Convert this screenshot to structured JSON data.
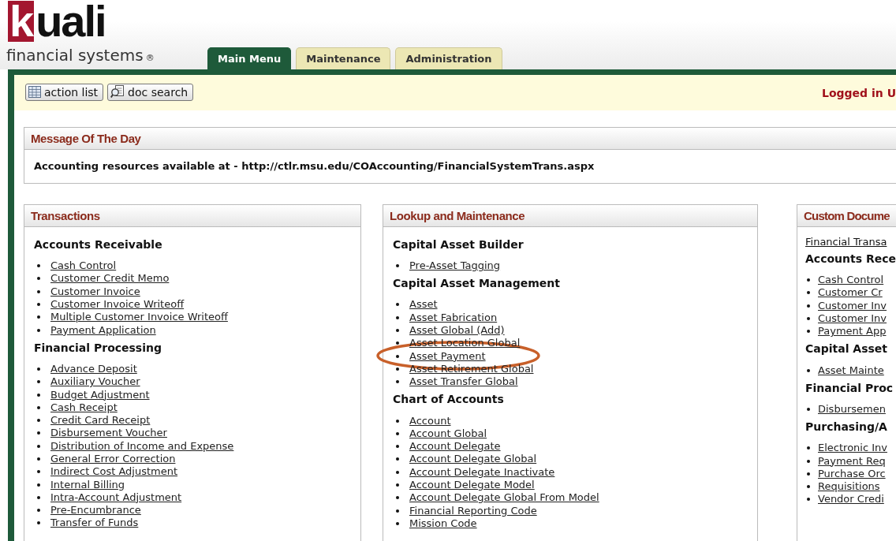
{
  "logo": {
    "word": "kuali",
    "subtitle": "financial systems",
    "mark": "®"
  },
  "tabs": [
    {
      "label": "Main Menu",
      "selected": true
    },
    {
      "label": "Maintenance",
      "selected": false
    },
    {
      "label": "Administration",
      "selected": false
    }
  ],
  "toolbar": {
    "buttons": [
      {
        "label": "action list",
        "kind": "list"
      },
      {
        "label": "doc search",
        "kind": "search"
      }
    ],
    "login_text": "Logged in U"
  },
  "message_of_the_day": {
    "title": "Message Of The Day",
    "text": "Accounting resources available at - http://ctlr.msu.edu/COAccounting/FinancialSystemTrans.aspx"
  },
  "panels": [
    {
      "title": "Transactions",
      "sections": [
        {
          "heading": "Accounts Receivable",
          "items": [
            {
              "label": "Cash Control",
              "circled": false
            },
            {
              "label": "Customer Credit Memo",
              "circled": false
            },
            {
              "label": "Customer Invoice",
              "circled": false
            },
            {
              "label": "Customer Invoice Writeoff",
              "circled": false
            },
            {
              "label": "Multiple Customer Invoice Writeoff",
              "circled": false
            },
            {
              "label": "Payment Application",
              "circled": false
            }
          ]
        },
        {
          "heading": "Financial Processing",
          "items": [
            {
              "label": "Advance Deposit",
              "circled": false
            },
            {
              "label": "Auxiliary Voucher",
              "circled": false
            },
            {
              "label": "Budget Adjustment",
              "circled": false
            },
            {
              "label": "Cash Receipt",
              "circled": false
            },
            {
              "label": "Credit Card Receipt",
              "circled": false
            },
            {
              "label": "Disbursement Voucher",
              "circled": false
            },
            {
              "label": "Distribution of Income and Expense",
              "circled": false
            },
            {
              "label": "General Error Correction",
              "circled": false
            },
            {
              "label": "Indirect Cost Adjustment",
              "circled": false
            },
            {
              "label": "Internal Billing",
              "circled": false
            },
            {
              "label": "Intra-Account Adjustment",
              "circled": false
            },
            {
              "label": "Pre-Encumbrance",
              "circled": false
            },
            {
              "label": "Transfer of Funds",
              "circled": false
            }
          ]
        }
      ]
    },
    {
      "title": "Lookup and Maintenance",
      "sections": [
        {
          "heading": "Capital Asset Builder",
          "items": [
            {
              "label": "Pre-Asset Tagging",
              "circled": false
            }
          ]
        },
        {
          "heading": "Capital Asset Management",
          "items": [
            {
              "label": "Asset",
              "circled": false
            },
            {
              "label": "Asset Fabrication",
              "circled": false
            },
            {
              "label": "Asset Global (Add)",
              "circled": false
            },
            {
              "label": "Asset Location Global",
              "circled": false
            },
            {
              "label": "Asset Payment",
              "circled": true
            },
            {
              "label": "Asset Retirement Global",
              "circled": false
            },
            {
              "label": "Asset Transfer Global",
              "circled": false
            }
          ]
        },
        {
          "heading": "Chart of Accounts",
          "items": [
            {
              "label": "Account",
              "circled": false
            },
            {
              "label": "Account Global",
              "circled": false
            },
            {
              "label": "Account Delegate",
              "circled": false
            },
            {
              "label": "Account Delegate Global",
              "circled": false
            },
            {
              "label": "Account Delegate Inactivate",
              "circled": false
            },
            {
              "label": "Account Delegate Model",
              "circled": false
            },
            {
              "label": "Account Delegate Global From Model",
              "circled": false
            },
            {
              "label": "Financial Reporting Code",
              "circled": false
            },
            {
              "label": "Mission Code",
              "circled": false
            }
          ]
        }
      ]
    },
    {
      "title": "Custom Docume",
      "top_links": [
        "Financial Transa"
      ],
      "sections": [
        {
          "heading": "Accounts Rece",
          "items": [
            {
              "label": "Cash Control",
              "circled": false
            },
            {
              "label": "Customer Cr",
              "circled": false
            },
            {
              "label": "Customer Inv",
              "circled": false
            },
            {
              "label": "Customer Inv",
              "circled": false
            },
            {
              "label": "Payment App",
              "circled": false
            }
          ]
        },
        {
          "heading": "Capital Asset",
          "items": [
            {
              "label": "Asset Mainte",
              "circled": false
            }
          ]
        },
        {
          "heading": "Financial Proc",
          "items": [
            {
              "label": "Disbursemen",
              "circled": false
            }
          ]
        },
        {
          "heading": "Purchasing/A",
          "items": [
            {
              "label": "Electronic Inv",
              "circled": false
            },
            {
              "label": "Payment Req",
              "circled": false
            },
            {
              "label": "Purchase Orc",
              "circled": false
            },
            {
              "label": "Requisitions",
              "circled": false
            },
            {
              "label": "Vendor Credi",
              "circled": false
            }
          ]
        }
      ]
    }
  ]
}
